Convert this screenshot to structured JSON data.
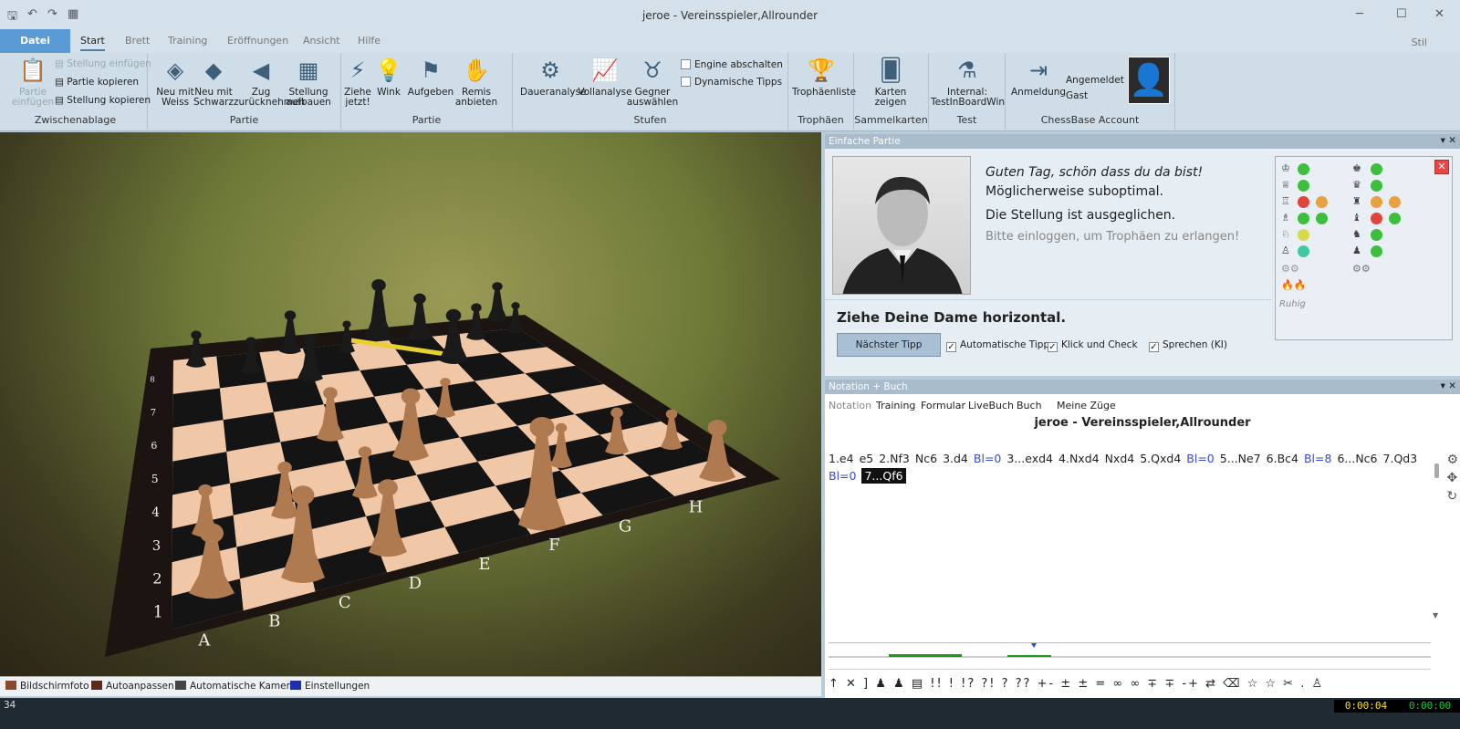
{
  "window": {
    "title": "jeroe - Vereinsspieler,Allrounder"
  },
  "menu_tabs": [
    "Datei",
    "Start",
    "Brett",
    "Training",
    "Eröffnungen",
    "Ansicht",
    "Hilfe"
  ],
  "stil_label": "Stil",
  "ribbon": {
    "clipboard": {
      "paste_game": "Partie einfügen",
      "paste_position": "Stellung einfügen",
      "copy_game": "Partie kopieren",
      "copy_position": "Stellung kopieren",
      "group": "Zwischenablage"
    },
    "game": {
      "new_white": "Neu mit Weiss",
      "new_black": "Neu mit Schwarz",
      "takeback": "Zug zurücknehmen",
      "setup": "Stellung aufbauen",
      "group": "Partie"
    },
    "game2": {
      "move_now": "Ziehe jetzt!",
      "hint": "Wink",
      "resign": "Aufgeben",
      "offer_draw": "Remis anbieten",
      "group": "Partie"
    },
    "levels": {
      "continuous": "Daueranalyse",
      "full": "Vollanalyse",
      "choose_opponent": "Gegner auswählen",
      "engine_off": "Engine abschalten",
      "dynamic_tips": "Dynamische Tipps",
      "group": "Stufen"
    },
    "trophies": {
      "list": "Trophäenliste",
      "group": "Trophäen"
    },
    "cards": {
      "show": "Karten zeigen",
      "group": "Sammelkarten"
    },
    "test": {
      "internal": "Internal: TestInBoardWin",
      "group": "Test"
    },
    "account": {
      "login": "Anmeldung",
      "logged_in": "Angemeldet",
      "guest": "Gast",
      "group": "ChessBase Account"
    }
  },
  "board": {
    "files": [
      "A",
      "B",
      "C",
      "D",
      "E",
      "F",
      "G",
      "H"
    ],
    "ranks": [
      "1",
      "2",
      "3",
      "4",
      "5",
      "6",
      "7",
      "8"
    ],
    "toolbar": {
      "screenshot": "Bildschirmfoto",
      "autofit": "Autoanpassen",
      "auto_camera": "Automatische Kamera",
      "settings": "Einstellungen"
    }
  },
  "coach_panel": {
    "header": "Einfache Partie",
    "greeting": "Guten Tag, schön dass du da bist!",
    "line2": "Möglicherweise suboptimal.",
    "line3": "Die Stellung ist ausgeglichen.",
    "line4": "Bitte einloggen, um Trophäen zu erlangen!",
    "hint": "Ziehe Deine Dame horizontal.",
    "next_tip": "Nächster Tipp",
    "auto_tips": "Automatische Tipps",
    "click_check": "Klick und Check",
    "speak": "Sprechen (KI)",
    "mood": "Ruhig",
    "colors": {
      "green": "#3cc03c",
      "red": "#e0443a",
      "orange": "#e8a040",
      "yellow": "#d8d84a",
      "teal": "#40c8a0"
    }
  },
  "notation_panel": {
    "header": "Notation + Buch",
    "tabs": [
      "Notation",
      "Training",
      "Formular",
      "LiveBuch",
      "Buch",
      "Meine Züge"
    ],
    "title": "jeroe - Vereinsspieler,Allrounder",
    "moves_line1": [
      "1.e4",
      "e5",
      "2.Nf3",
      "Nc6",
      "3.d4",
      "Bl=0",
      "3...exd4",
      "4.Nxd4",
      "Nxd4",
      "5.Qxd4",
      "Bl=0",
      "5...Ne7",
      "6.Bc4",
      "Bl=8",
      "6...Nc6",
      "7.Qd3"
    ],
    "moves_line2": [
      "Bl=0",
      "7...Qf6"
    ],
    "symbols": "↑ ✕ ] ♟ ♟ ▤ !! ! !? ?! ? ?? +- ± ± = ∞ ∞ ∓ ∓ -+ ⇄ ⌫ ☆ ☆ ✂ . ♙"
  },
  "status": {
    "left": "34",
    "clock_white": "0:00:04",
    "clock_black": "0:00:00"
  }
}
